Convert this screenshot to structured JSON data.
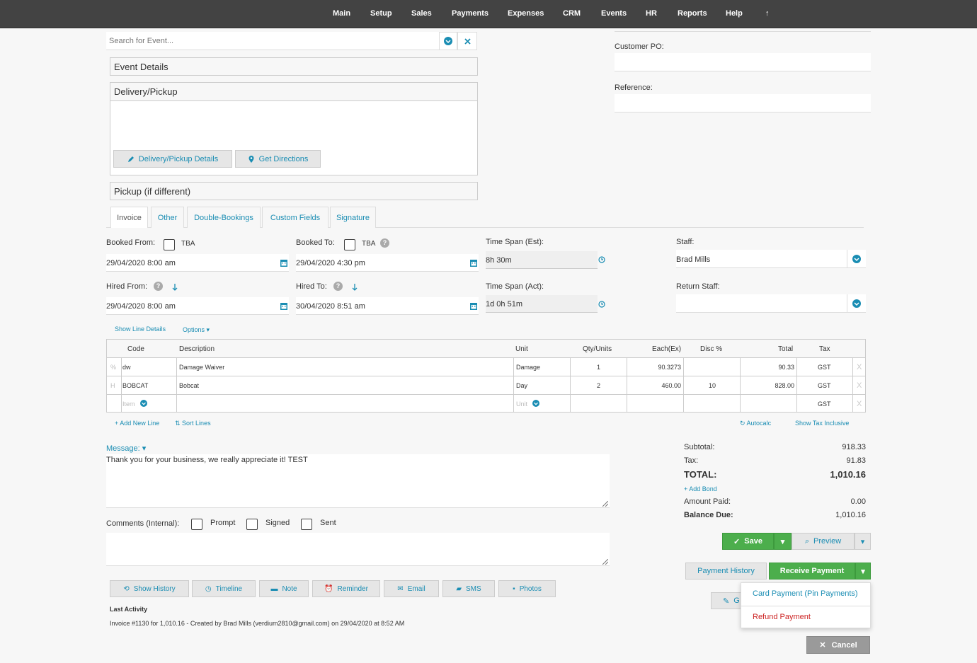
{
  "nav": [
    "Main",
    "Setup",
    "Sales",
    "Payments",
    "Expenses",
    "CRM",
    "Events",
    "HR",
    "Reports",
    "Help",
    "↑"
  ],
  "search": {
    "placeholder": "Search for Event..."
  },
  "panels": {
    "event_details": "Event Details",
    "delivery_pickup": "Delivery/Pickup",
    "delivery_details_btn": "Delivery/Pickup Details",
    "get_directions_btn": "Get Directions",
    "pickup": "Pickup (if different)"
  },
  "right_fields": {
    "customer_po": "Customer PO:",
    "reference": "Reference:"
  },
  "tabs": [
    "Invoice",
    "Other",
    "Double-Bookings",
    "Custom Fields",
    "Signature"
  ],
  "booking": {
    "booked_from_label": "Booked From:",
    "booked_to_label": "Booked To:",
    "tba": "TBA",
    "booked_from": "29/04/2020 8:00 am",
    "booked_to": "29/04/2020 4:30 pm",
    "time_span_est_label": "Time Span (Est):",
    "time_span_est": "8h 30m",
    "staff_label": "Staff:",
    "staff": "Brad Mills",
    "hired_from_label": "Hired From:",
    "hired_to_label": "Hired To:",
    "hired_from": "29/04/2020 8:00 am",
    "hired_to": "30/04/2020 8:51 am",
    "time_span_act_label": "Time Span (Act):",
    "time_span_act": "1d 0h 51m",
    "return_staff_label": "Return Staff:"
  },
  "line_links": {
    "show_line_details": "Show Line Details",
    "options": "Options"
  },
  "table": {
    "headers": {
      "code": "Code",
      "description": "Description",
      "unit": "Unit",
      "qty": "Qty/Units",
      "each": "Each(Ex)",
      "disc": "Disc %",
      "total": "Total",
      "tax": "Tax"
    },
    "rows": [
      {
        "flag": "%",
        "code": "dw",
        "description": "Damage Waiver",
        "unit": "Damage",
        "qty": "1",
        "each": "90.3273",
        "disc": "",
        "total": "90.33",
        "tax": "GST"
      },
      {
        "flag": "H",
        "code": "BOBCAT",
        "description": "Bobcat",
        "unit": "Day",
        "qty": "2",
        "each": "460.00",
        "disc": "10",
        "total": "828.00",
        "tax": "GST"
      }
    ],
    "new_row": {
      "item_placeholder": "Item",
      "unit_placeholder": "Unit",
      "tax": "GST"
    }
  },
  "table_links": {
    "add_new_line": "+ Add New Line",
    "sort_lines": "Sort Lines",
    "autocalc": "Autocalc",
    "show_tax_inclusive": "Show Tax Inclusive"
  },
  "message": {
    "label": "Message:",
    "text": "Thank you for your business, we really appreciate it! TEST"
  },
  "comments": {
    "label": "Comments (Internal):",
    "prompt": "Prompt",
    "signed": "Signed",
    "sent": "Sent"
  },
  "totals": {
    "subtotal_label": "Subtotal:",
    "subtotal": "918.33",
    "tax_label": "Tax:",
    "tax": "91.83",
    "total_label": "TOTAL:",
    "total": "1,010.16",
    "add_bond": "+ Add Bond",
    "amount_paid_label": "Amount Paid:",
    "amount_paid": "0.00",
    "balance_due_label": "Balance Due:",
    "balance_due": "1,010.16"
  },
  "actions": {
    "save": "Save",
    "preview": "Preview",
    "payment_history": "Payment History",
    "receive_payment": "Receive Payment",
    "dropdown": {
      "card_payment": "Card Payment (Pin Payments)",
      "refund_payment": "Refund Payment"
    },
    "partial_label": "G",
    "cancel": "Cancel"
  },
  "bottom_buttons": [
    "Show History",
    "Timeline",
    "Note",
    "Reminder",
    "Email",
    "SMS",
    "Photos"
  ],
  "last_activity": {
    "title": "Last Activity",
    "text": "Invoice #1130 for 1,010.16 - Created by Brad Mills (verdium2810@gmail.com) on 29/04/2020 at 8:52 AM"
  },
  "colors": {
    "accent": "#1a8db3",
    "green": "#4cae4c",
    "danger": "#cc2222",
    "topbar": "#434343"
  }
}
